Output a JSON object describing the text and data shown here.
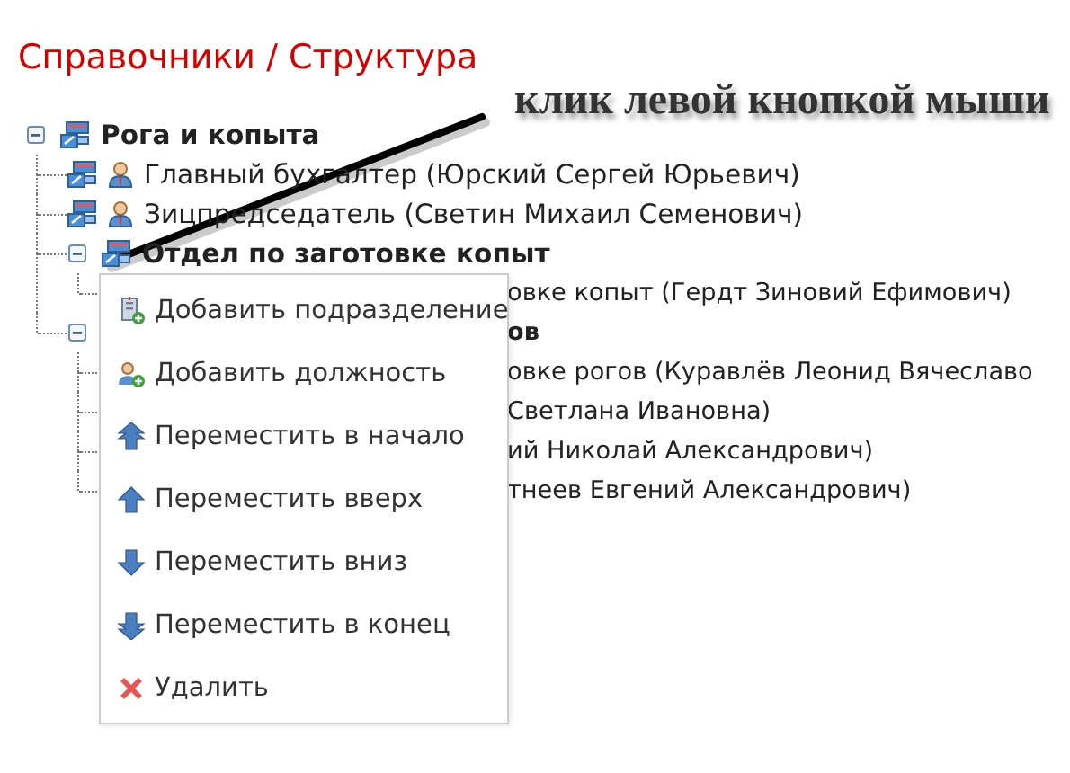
{
  "breadcrumb": "Справочники / Структура",
  "annotation": "клик левой кнопкой мыши",
  "tree": [
    {
      "kind": "department",
      "label": "Рога и копыта",
      "expanded": true,
      "children": [
        {
          "kind": "position",
          "label": "Главный бухгалтер (Юрский Сергей Юрьевич)"
        },
        {
          "kind": "position",
          "label": "Зицпредседатель (Светин Михаил Семенович)"
        },
        {
          "kind": "department",
          "label": "Отдел по заготовке копыт",
          "expanded": true,
          "children": [
            {
              "kind": "position",
              "covered": true,
              "label": "овке копыт (Гердт Зиновий Ефимович)"
            }
          ]
        },
        {
          "kind": "department",
          "covered": true,
          "label": "ов",
          "expanded": true,
          "children": [
            {
              "kind": "position",
              "covered": true,
              "label": "овке рогов (Куравлёв Леонид Вячеславо"
            },
            {
              "kind": "position",
              "covered": true,
              "label": "Светлана Ивановна)"
            },
            {
              "kind": "position",
              "covered": true,
              "label": "ий Николай Александрович)"
            },
            {
              "kind": "position",
              "covered": true,
              "label": "тнеев Евгений Александрович)"
            }
          ]
        }
      ]
    }
  ],
  "context_menu": [
    {
      "kind": "add-unit",
      "label": "Добавить подразделение"
    },
    {
      "kind": "add-position",
      "label": "Добавить должность"
    },
    {
      "kind": "move-first",
      "label": "Переместить в начало"
    },
    {
      "kind": "move-up",
      "label": "Переместить вверх"
    },
    {
      "kind": "move-down",
      "label": "Переместить вниз"
    },
    {
      "kind": "move-last",
      "label": "Переместить в конец"
    },
    {
      "kind": "delete",
      "label": "Удалить"
    }
  ]
}
